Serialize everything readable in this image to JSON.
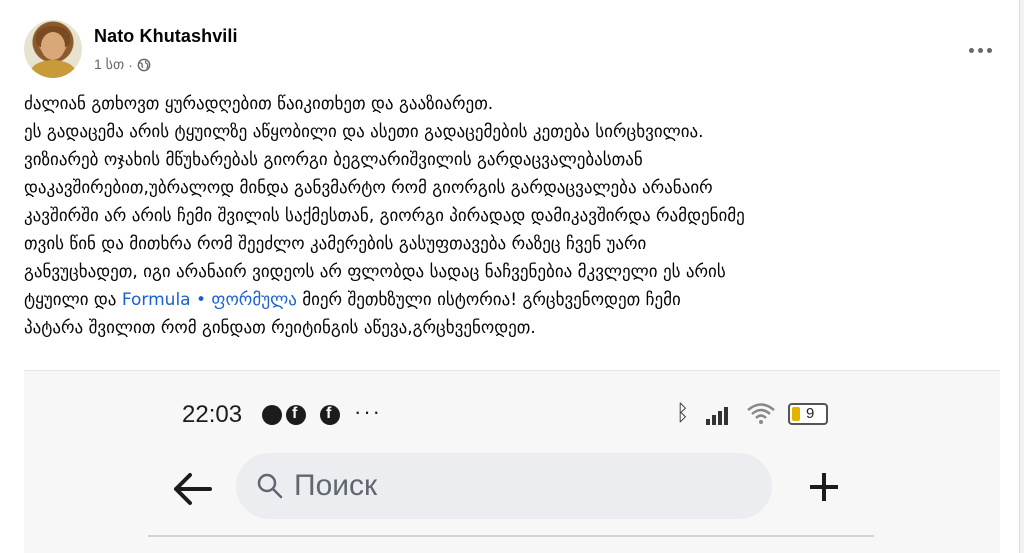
{
  "post": {
    "author": "Nato Khutashvili",
    "time": "1 სთ",
    "separator": "·",
    "privacy_icon": "globe-icon",
    "more_icon": "more-horizontal-icon",
    "text_lines": [
      "ძალიან გთხოვთ ყურადღებით წაიკითხეთ და გააზიარეთ.",
      "ეს გადაცემა არის ტყუილზე აწყობილი და ასეთი გადაცემების კეთება სირცხვილია.",
      "ვიზიარებ ოჯახის მწუხარებას გიორგი ბეგლარიშვილის გარდაცვალებასთან",
      "დაკავშირებით,უბრალოდ მინდა განვმარტო რომ გიორგის გარდაცვალება არანაირ",
      "კავშირში არ არის ჩემი შვილის საქმესთან, გიორგი პირადად დამიკავშირდა რამდენიმე",
      "თვის წინ და მითხრა რომ შეეძლო კამერების გასუფთავება რაზეც ჩვენ უარი",
      "განვუცხადეთ, იგი არანაირ ვიდეოს არ ფლობდა სადაც ნაჩვენებია მკვლელი ეს არის"
    ],
    "line8_before": "ტყუილი და ",
    "hashtag": "Formula • ფორმულა",
    "line8_after": "   მიერ შეთხზული ისტორია! გრცხვენოდეთ ჩემი",
    "line9": "პატარა შვილით რომ გინდათ რეიტინგის აწევა,გრცხვენოდეთ."
  },
  "phone": {
    "time": "22:03",
    "status_icons": [
      "messenger-icon",
      "facebook-icon",
      "facebook-icon"
    ],
    "status_dots": "···",
    "battery_level": "9",
    "search_placeholder": "Поиск",
    "back_icon": "arrow-left-icon",
    "plus_icon": "plus-icon"
  },
  "colors": {
    "hashtag": "#1b5fd1",
    "text": "#050505",
    "meta": "#65676b",
    "search_bg": "#ebedf0"
  }
}
